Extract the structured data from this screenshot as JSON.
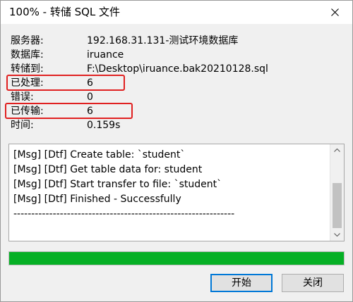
{
  "window": {
    "title": "100% - 转储 SQL 文件"
  },
  "info": [
    {
      "label": "服务器:",
      "value": "192.168.31.131-测试环境数据库"
    },
    {
      "label": "数据库:",
      "value": "iruance"
    },
    {
      "label": "转储到:",
      "value": "F:\\Desktop\\iruance.bak20210128.sql"
    },
    {
      "label": "已处理:",
      "value": "6"
    },
    {
      "label": "错误:",
      "value": "0"
    },
    {
      "label": "已传输:",
      "value": "6"
    },
    {
      "label": "时间:",
      "value": "0.159s"
    }
  ],
  "log": [
    "[Msg] [Dtf] Create table: `student`",
    "[Msg] [Dtf] Get table data for: student",
    "[Msg] [Dtf] Start transfer to file: `student`",
    "[Msg] [Dtf] Finished - Successfully",
    "--------------------------------------------------------------"
  ],
  "progress": {
    "percent": 100,
    "color": "#06b025"
  },
  "buttons": {
    "start": "开始",
    "close": "关闭"
  },
  "colors": {
    "highlight": "#e02020",
    "default_button_border": "#0078d7"
  }
}
